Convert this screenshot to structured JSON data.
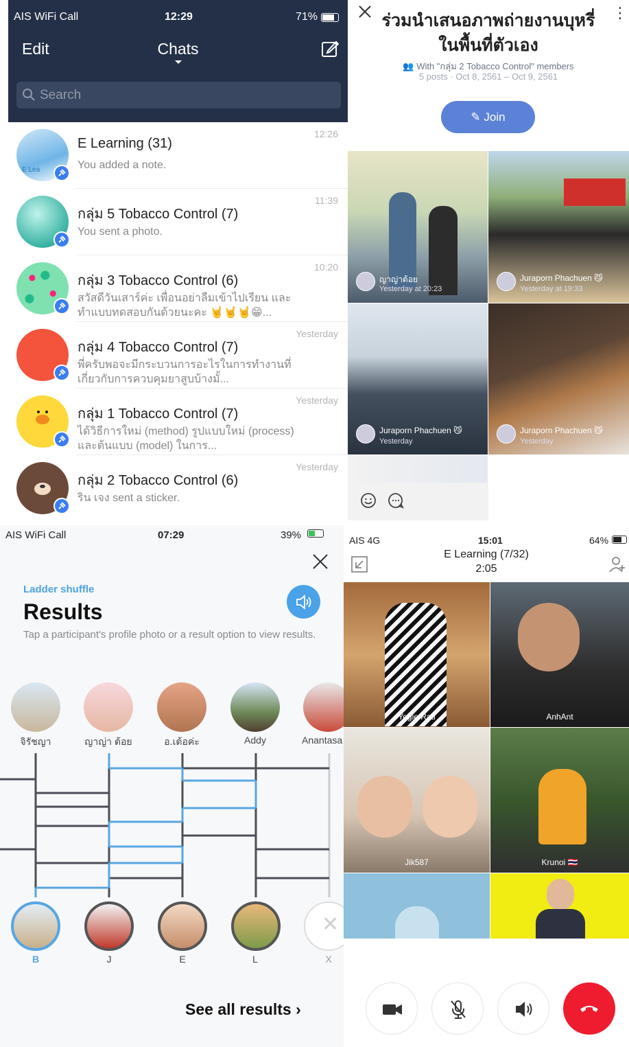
{
  "chats_screen": {
    "status": {
      "carrier": "AIS WiFi Call",
      "time": "12:29",
      "battery": "71%"
    },
    "nav": {
      "edit": "Edit",
      "title": "Chats"
    },
    "search_placeholder": "Search",
    "rows": [
      {
        "title": "E Learning (31)",
        "message": "You added a note.",
        "time": "12:26",
        "avatar_label": "E Lea"
      },
      {
        "title": "กลุ่ม 5 Tobacco Control (7)",
        "message": "You sent a photo.",
        "time": "11:39"
      },
      {
        "title": "กลุ่ม 3 Tobacco Control (6)",
        "message": "สวัสดีวันเสาร์ค่ะ เพื่อนอย่าลืมเข้าไปเรียน และทำแบบทดสอบกันด้วยนะคะ 🤘🤘🤘😁...",
        "time": "10:20"
      },
      {
        "title": "กลุ่ม 4 Tobacco Control (7)",
        "message": "พี่ครับพอจะมีกระบวนการอะไรในการทำงานที่เกี่ยวกับการควบคุมยาสูบบ้างมั้...",
        "time": "Yesterday"
      },
      {
        "title": "กลุ่ม 1 Tobacco Control (7)",
        "message": "ได้วิธีการใหม่ (method) รูปแบบใหม่ (process) และต้นแบบ (model) ในการ...",
        "time": "Yesterday"
      },
      {
        "title": "กลุ่ม 2 Tobacco Control (6)",
        "message": "ริน เจง sent a sticker.",
        "time": "Yesterday"
      }
    ]
  },
  "album_screen": {
    "title": "ร่วมนำเสนอภาพถ่ายงานบุหรี่ในพื้นที่ตัวเอง",
    "with_text": "With \"กลุ่ม 2 Tobacco Control\" members",
    "meta": "5 posts · Oct 8, 2561 – Oct 9, 2561",
    "join_label": "Join",
    "tiles": [
      {
        "name": "ญาญ่าต้อย",
        "time": "Yesterday at 20:23"
      },
      {
        "name": "Juraporn Phachuen 😼",
        "time": "Yesterday at 19:33"
      },
      {
        "name": "Juraporn Phachuen 😼",
        "time": "Yesterday"
      },
      {
        "name": "Juraporn Phachuen 😼",
        "time": "Yesterday"
      }
    ]
  },
  "ladder_screen": {
    "status": {
      "carrier": "AIS WiFi Call",
      "time": "07:29",
      "battery": "39%"
    },
    "kicker": "Ladder shuffle",
    "title": "Results",
    "subtitle": "Tap a participant's profile photo or a result option to view results.",
    "participants": [
      "จิรัชญา",
      "ญาญ่า ต้อย",
      "อ.เต้อค่ะ",
      "Addy",
      "Anantasa anput"
    ],
    "results": [
      "B",
      "J",
      "E",
      "L",
      "X"
    ],
    "see_all": "See all results"
  },
  "call_screen": {
    "status": {
      "carrier": "AIS 4G",
      "time": "15:01",
      "battery": "64%"
    },
    "title": "E Learning (7/32)",
    "duration": "2:05",
    "participants": [
      "Yogie Rati",
      "AnhAnt",
      "Jik587",
      "Krunoi 🇹🇭"
    ]
  },
  "colors": {
    "navy": "#243047",
    "accent": "#4aa2e8",
    "end_call": "#ef1c2f",
    "join": "#5c82d8"
  }
}
